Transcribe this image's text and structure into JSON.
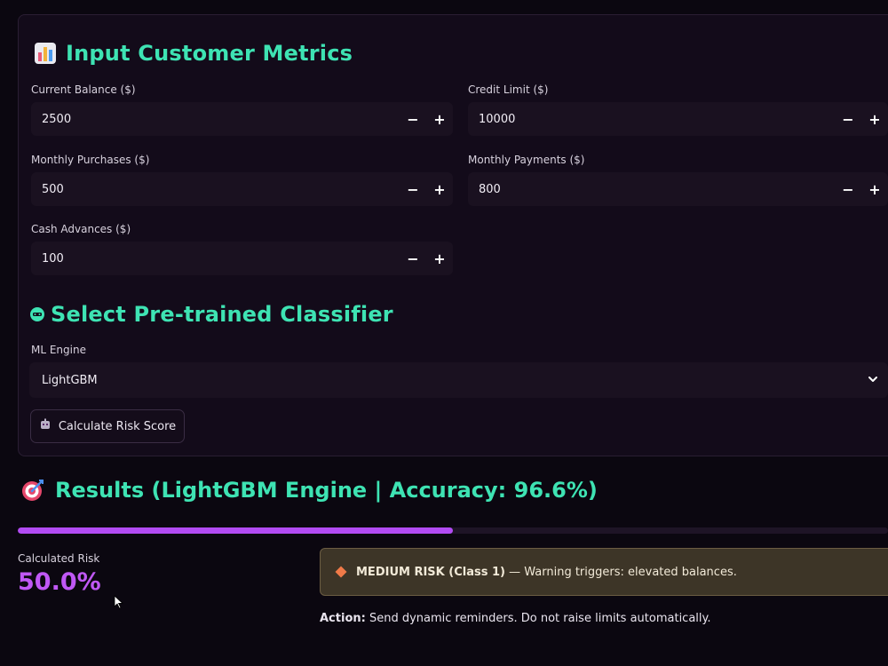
{
  "input_section": {
    "title": "Input Customer Metrics",
    "icon": "bar-chart-icon"
  },
  "fields": {
    "current_balance": {
      "label": "Current Balance ($)",
      "value": "2500"
    },
    "credit_limit": {
      "label": "Credit Limit ($)",
      "value": "10000"
    },
    "monthly_purchases": {
      "label": "Monthly Purchases ($)",
      "value": "500"
    },
    "monthly_payments": {
      "label": "Monthly Payments ($)",
      "value": "800"
    },
    "cash_advances": {
      "label": "Cash Advances ($)",
      "value": "100"
    }
  },
  "stepper": {
    "minus": "−",
    "plus": "+"
  },
  "classifier_section": {
    "title": "Select Pre-trained Classifier",
    "icon": "robot-face-icon"
  },
  "ml_engine": {
    "label": "ML Engine",
    "selected": "LightGBM"
  },
  "calculate_button": {
    "label": "Calculate Risk Score",
    "icon": "robot-icon"
  },
  "results": {
    "title": "Results (LightGBM Engine | Accuracy: 96.6%)",
    "icon": "target-icon",
    "progress": 0.5,
    "metric_label": "Calculated Risk",
    "metric_value": "50.0%"
  },
  "alert": {
    "icon": "orange-diamond-icon",
    "strong": "MEDIUM RISK (Class 1)",
    "rest": " — Warning triggers: elevated balances."
  },
  "action": {
    "label": "Action:",
    "text": " Send dynamic reminders. Do not raise limits automatically."
  },
  "colors": {
    "accent_heading": "#3ee3b3",
    "progress": "#b24bf3",
    "metric_value": "#c058f5",
    "warning_bg": "#3d3527"
  }
}
